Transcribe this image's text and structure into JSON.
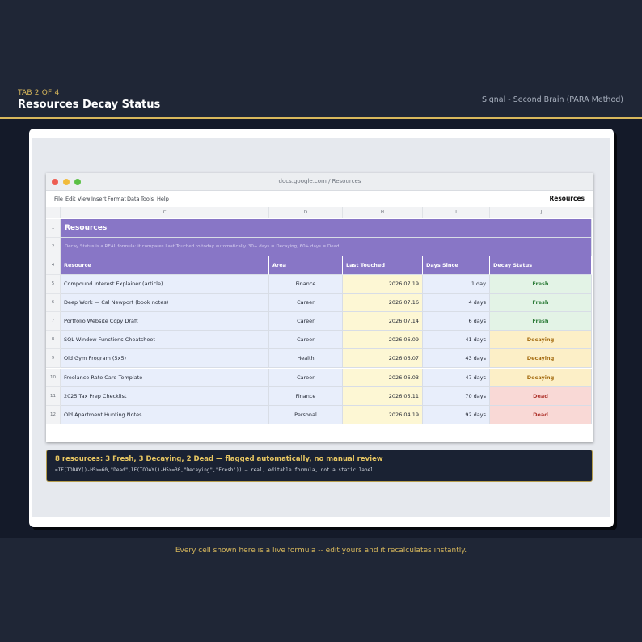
{
  "header": {
    "tab_label": "TAB 2 OF 4",
    "title": "Resources Decay Status",
    "brand": "Signal - Second Brain (PARA Method)"
  },
  "browser": {
    "url": "docs.google.com / Resources",
    "menu": [
      "File",
      "Edit",
      "View",
      "Insert",
      "Format",
      "Data",
      "Tools",
      "Help"
    ],
    "doc_name": "Resources"
  },
  "sheet": {
    "col_letters": [
      "C",
      "D",
      "H",
      "I",
      "J"
    ],
    "banner_title": "Resources",
    "banner_subtitle": "Decay Status is a REAL formula: it compares Last Touched to today automatically. 30+ days = Decaying, 60+ days = Dead",
    "row_numbers": [
      "1",
      "2",
      "4",
      "5",
      "6",
      "7",
      "8",
      "9",
      "10",
      "11",
      "12"
    ],
    "headers": [
      "Resource",
      "Area",
      "Last Touched",
      "Days Since",
      "Decay Status"
    ],
    "rows": [
      {
        "resource": "Compound Interest Explainer (article)",
        "area": "Finance",
        "last": "2026.07.19",
        "days": "1 day",
        "status": "Fresh"
      },
      {
        "resource": "Deep Work — Cal Newport (book notes)",
        "area": "Career",
        "last": "2026.07.16",
        "days": "4 days",
        "status": "Fresh"
      },
      {
        "resource": "Portfolio Website Copy Draft",
        "area": "Career",
        "last": "2026.07.14",
        "days": "6 days",
        "status": "Fresh"
      },
      {
        "resource": "SQL Window Functions Cheatsheet",
        "area": "Career",
        "last": "2026.06.09",
        "days": "41 days",
        "status": "Decaying"
      },
      {
        "resource": "Old Gym Program (5x5)",
        "area": "Health",
        "last": "2026.06.07",
        "days": "43 days",
        "status": "Decaying"
      },
      {
        "resource": "Freelance Rate Card Template",
        "area": "Career",
        "last": "2026.06.03",
        "days": "47 days",
        "status": "Decaying"
      },
      {
        "resource": "2025 Tax Prep Checklist",
        "area": "Finance",
        "last": "2026.05.11",
        "days": "70 days",
        "status": "Dead"
      },
      {
        "resource": "Old Apartment Hunting Notes",
        "area": "Personal",
        "last": "2026.04.19",
        "days": "92 days",
        "status": "Dead"
      }
    ]
  },
  "status_colors": {
    "Fresh": {
      "bg": "#e3f3e6",
      "fg": "#2e7d3a"
    },
    "Decaying": {
      "bg": "#fcefc7",
      "fg": "#a56d12"
    },
    "Dead": {
      "bg": "#f9d9d6",
      "fg": "#b0362f"
    }
  },
  "summary": {
    "title": "8 resources: 3 Fresh, 3 Decaying, 2 Dead — flagged automatically, no manual review",
    "formula": "=IF(TODAY()-H5>=60,\"Dead\",IF(TODAY()-H5>=30,\"Decaying\",\"Fresh\")) — real, editable formula, not a static label"
  },
  "footer": {
    "text": "Every cell shown here is a live formula -- edit yours and it recalculates instantly."
  }
}
